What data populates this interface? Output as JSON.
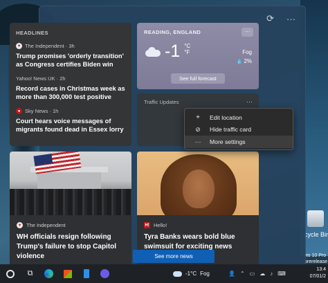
{
  "panel": {
    "refresh_icon": "⟳",
    "more_icon": "···"
  },
  "headlines": {
    "title": "HEADLINES",
    "items": [
      {
        "logo": "♥",
        "source": "The Independent · 3h",
        "text": "Trump promises 'orderly transition' as Congress certifies Biden win"
      },
      {
        "logo": "",
        "source": "Yahoo! News UK · 2h",
        "text": "Record cases in Christmas week as more than 300,000 test positive"
      },
      {
        "logo": "●",
        "source": "Sky News · 1h",
        "text": "Court hears voice messages of migrants found dead in Essex lorry"
      }
    ]
  },
  "weather": {
    "location": "READING, ENGLAND",
    "more": "···",
    "temp": "-1",
    "unit_c": "°C",
    "unit_f": "°F",
    "condition": "Fog",
    "precip": "2%",
    "precip_icon": "💧",
    "forecast_button": "See full forecast"
  },
  "traffic": {
    "title": "Traffic Updates",
    "more": "···"
  },
  "context_menu": {
    "items": [
      {
        "icon": "⌖",
        "label": "Edit location"
      },
      {
        "icon": "⊘",
        "label": "Hide traffic card"
      },
      {
        "icon": "···",
        "label": "More settings"
      }
    ]
  },
  "stories": [
    {
      "logo": "♥",
      "source": "The Independent",
      "text": "WH officials resign following Trump's failure to stop Capitol violence"
    },
    {
      "logo": "H!",
      "source": "Hello!",
      "text": "Tyra Banks wears bold blue swimsuit for exciting news"
    }
  ],
  "see_more": "See more news",
  "taskbar": {
    "weather_temp": "-1°C",
    "weather_condition": "Fog",
    "clock_time": "13:4",
    "clock_date": "07/01/2"
  },
  "desktop": {
    "label_1": "cycle Bin",
    "watermark_1": "ws 10 Pro",
    "watermark_2": "prerelease"
  }
}
